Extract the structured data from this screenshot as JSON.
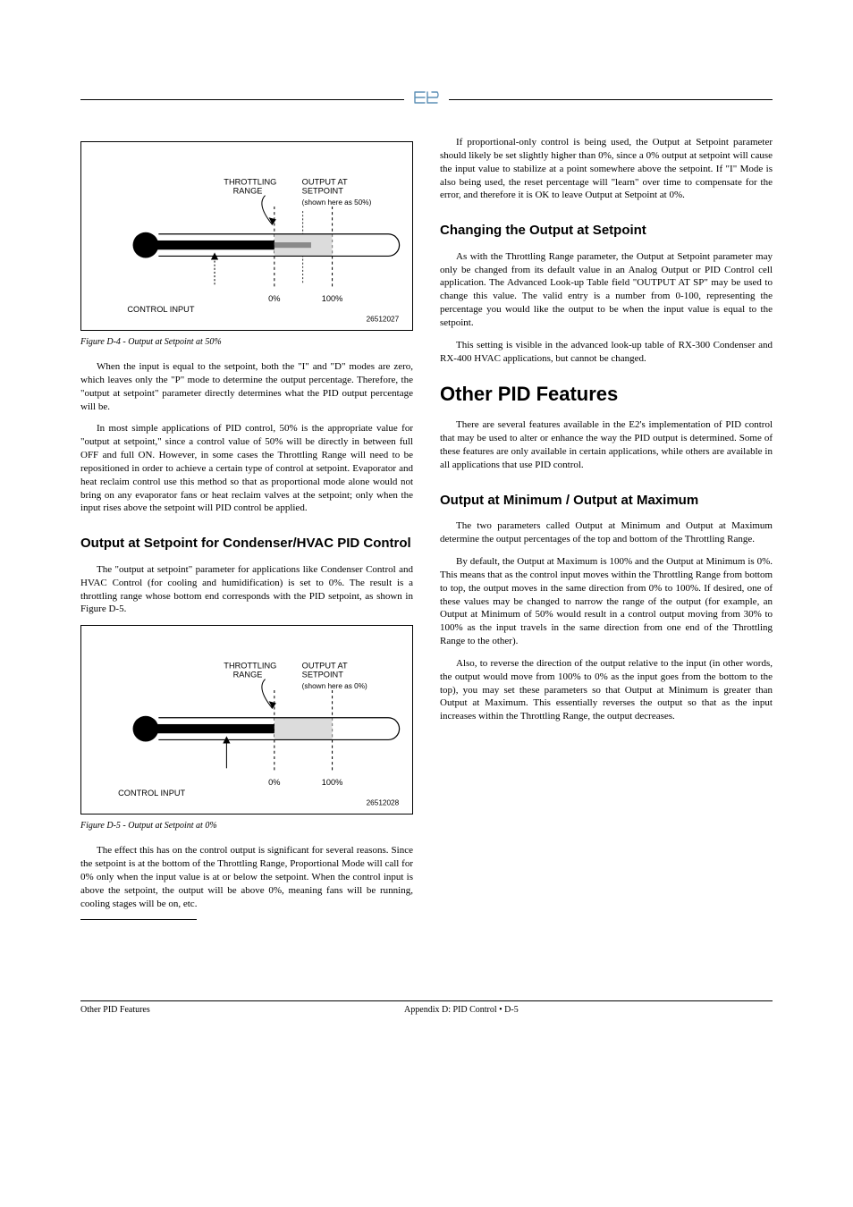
{
  "left": {
    "fig4": {
      "labels": {
        "throttling": "THROTTLING\nRANGE",
        "output_at": "OUTPUT AT\nSETPOINT",
        "shown": "(shown here as 50%)",
        "zero": "0%",
        "hundred": "100%",
        "control": "CONTROL INPUT",
        "code": "26512027"
      },
      "caption": "Figure D-4 - Output at Setpoint at 50%"
    },
    "p1": "When the input is equal to the setpoint, both the \"I\" and \"D\" modes are zero, which leaves only the \"P\" mode to determine the output percentage. Therefore, the \"output at setpoint\" parameter directly determines what the PID output percentage will be.",
    "p2": "In most simple applications of PID control, 50% is the appropriate value for \"output at setpoint,\" since a control value of 50% will be directly in between full OFF and full ON. However, in some cases the Throttling Range will need to be repositioned in order to achieve a certain type of control at setpoint. Evaporator and heat reclaim control use this method so that as proportional mode alone would not bring on any evaporator fans or heat reclaim valves at the setpoint; only when the input rises above the setpoint will PID control be applied.",
    "h3_sec": "Output at Setpoint for Condenser/HVAC PID Control",
    "p3": "The \"output at setpoint\" parameter for applications like Condenser Control and HVAC Control (for cooling and humidification) is set to 0%. The result is a throttling range whose bottom end corresponds with the PID setpoint, as shown in Figure D-5.",
    "fig5": {
      "labels": {
        "throttling": "THROTTLING\nRANGE",
        "output_at": "OUTPUT AT\nSETPOINT",
        "shown": "(shown here as 0%)",
        "zero": "0%",
        "hundred": "100%",
        "control": "CONTROL INPUT",
        "code": "26512028"
      },
      "caption": "Figure D-5 - Output at Setpoint at 0%"
    },
    "p4": "The effect this has on the control output is significant for several reasons. Since the setpoint is at the bottom of the Throttling Range, Proportional Mode will call for 0% only when the input value is at or below the setpoint. When the control input is above the setpoint, the output will be above 0%, meaning fans will be running, cooling stages will be on, etc."
  },
  "right": {
    "p5": "If proportional-only control is being used, the Output at Setpoint parameter should likely be set slightly higher than 0%, since a 0% output at setpoint will cause the input value to stabilize at a point somewhere above the setpoint. If \"I\" Mode is also being used, the reset percentage will \"learn\" over time to compensate for the error, and therefore it is OK to leave Output at Setpoint at 0%.",
    "h3_change": "Changing the Output at Setpoint",
    "p6": "As with the Throttling Range parameter, the Output at Setpoint parameter may only be changed from its default value in an Analog Output or PID Control cell application. The Advanced Look-up Table field \"OUTPUT AT SP\" may be used to change this value. The valid entry is a number from 0-100, representing the percentage you would like the output to be when the input value is equal to the setpoint.",
    "p7": "This setting is visible in the advanced look-up table of RX-300 Condenser and RX-400 HVAC applications, but cannot be changed.",
    "h2_other": "Other PID Features",
    "p8": "There are several features available in the E2's implementation of PID control that may be used to alter or enhance the way the PID output is determined. Some of these features are only available in certain applications, while others are available in all applications that use PID control.",
    "h3_minmax": "Output at Minimum / Output at Maximum",
    "p9": "The two parameters called Output at Minimum and Output at Maximum determine the output percentages of the top and bottom of the Throttling Range.",
    "p10": "By default, the Output at Maximum is 100% and the Output at Minimum is 0%. This means that as the control input moves within the Throttling Range from bottom to top, the output moves in the same direction from 0% to 100%. If desired, one of these values may be changed to narrow the range of the output (for example, an Output at Minimum of 50% would result in a control output moving from 30% to 100% as the input travels in the same direction from one end of the Throttling Range to the other).",
    "p11": "Also, to reverse the direction of the output relative to the input (in other words, the output would move from 100% to 0% as the input goes from the bottom to the top), you may set these parameters so that Output at Minimum is greater than Output at Maximum. This essentially reverses the output so that as the input increases within the Throttling Range, the output decreases."
  },
  "footer": {
    "left": "Other PID Features",
    "middle": "Appendix D: PID Control • D-5",
    "right": ""
  }
}
